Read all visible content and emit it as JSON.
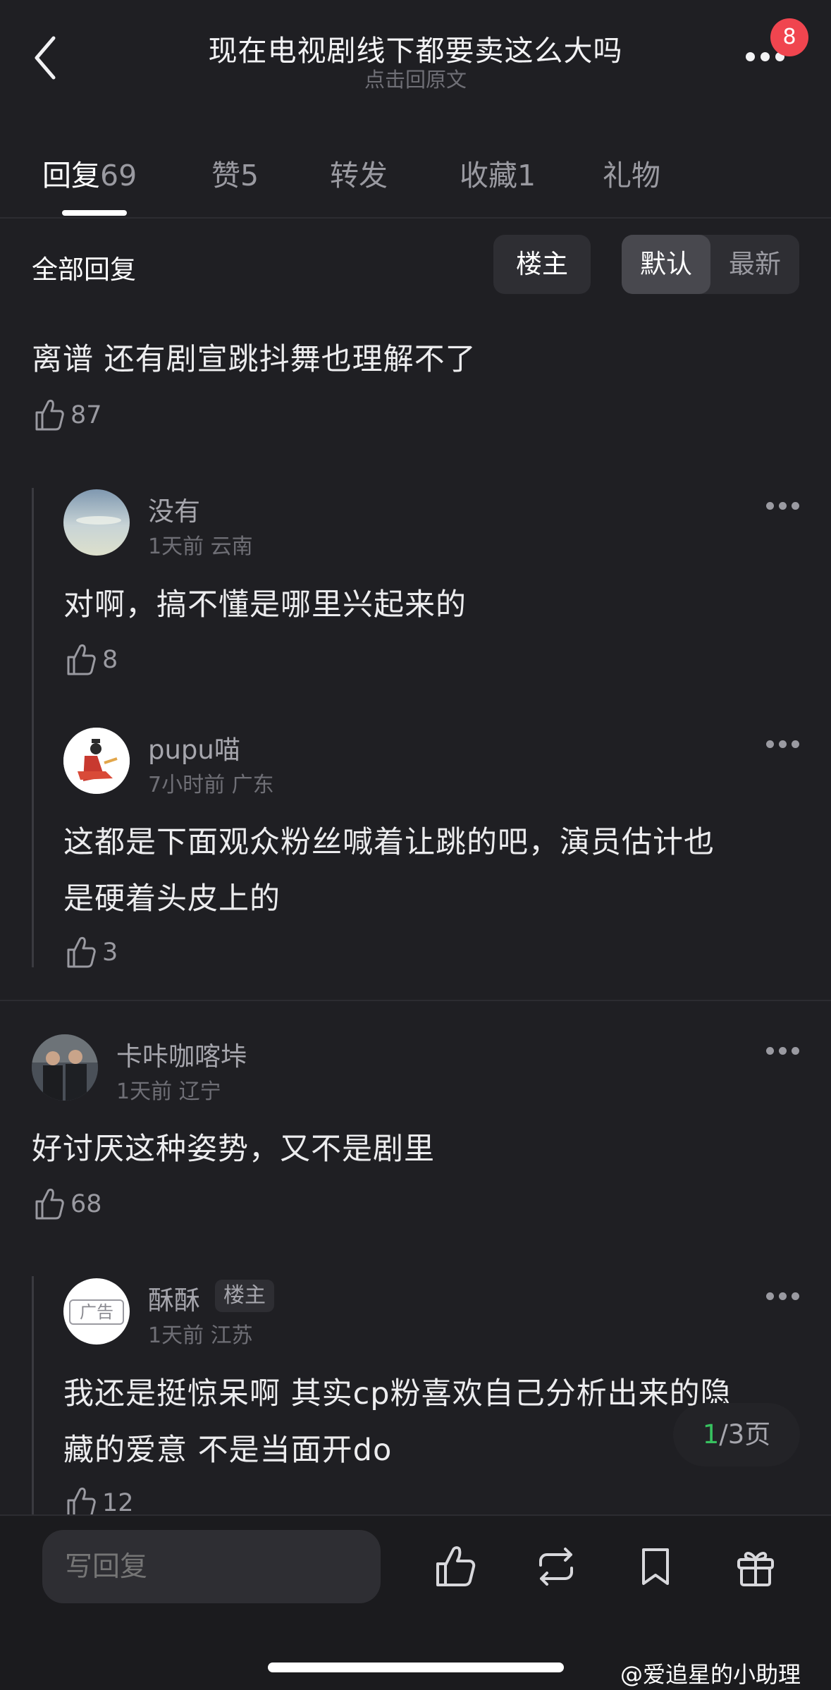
{
  "header": {
    "title": "现在电视剧线下都要卖这么大吗",
    "subtitle": "点击回原文",
    "notification_count": "8"
  },
  "tabs": [
    {
      "label": "回复",
      "count": "69"
    },
    {
      "label": "赞",
      "count": "5"
    },
    {
      "label": "转发",
      "count": ""
    },
    {
      "label": "收藏",
      "count": "1"
    },
    {
      "label": "礼物",
      "count": ""
    }
  ],
  "filter": {
    "title": "全部回复",
    "owner_label": "楼主",
    "sort_default": "默认",
    "sort_latest": "最新"
  },
  "comments": [
    {
      "text": "离谱 还有剧宣跳抖舞也理解不了",
      "likes": "87",
      "replies": [
        {
          "name": "没有",
          "time": "1天前",
          "location": "云南",
          "text": "对啊，搞不懂是哪里兴起来的",
          "likes": "8"
        },
        {
          "name": "pupu喵",
          "time": "7小时前",
          "location": "广东",
          "text_line1": "这都是下面观众粉丝喊着让跳的吧，演员估计也",
          "text_line2": "是硬着头皮上的",
          "likes": "3"
        }
      ]
    },
    {
      "name": "卡咔咖喀垰",
      "time": "1天前",
      "location": "辽宁",
      "text": "好讨厌这种姿势，又不是剧里",
      "likes": "68",
      "replies": [
        {
          "name": "酥酥",
          "tag": "楼主",
          "avatar_text": "广告",
          "time": "1天前",
          "location": "江苏",
          "text_line1": "我还是挺惊呆啊 其实cp粉喜欢自己分析出来的隐",
          "text_line2": "藏的爱意 不是当面开do",
          "likes": "12"
        }
      ]
    }
  ],
  "pager": {
    "current": "1",
    "rest": "/3页"
  },
  "bottom_bar": {
    "reply_placeholder": "写回复"
  },
  "watermark": "@爱追星的小助理",
  "colors": {
    "background": "#1f1f23",
    "badge": "#f0454f",
    "pager_current": "#37c15f"
  }
}
